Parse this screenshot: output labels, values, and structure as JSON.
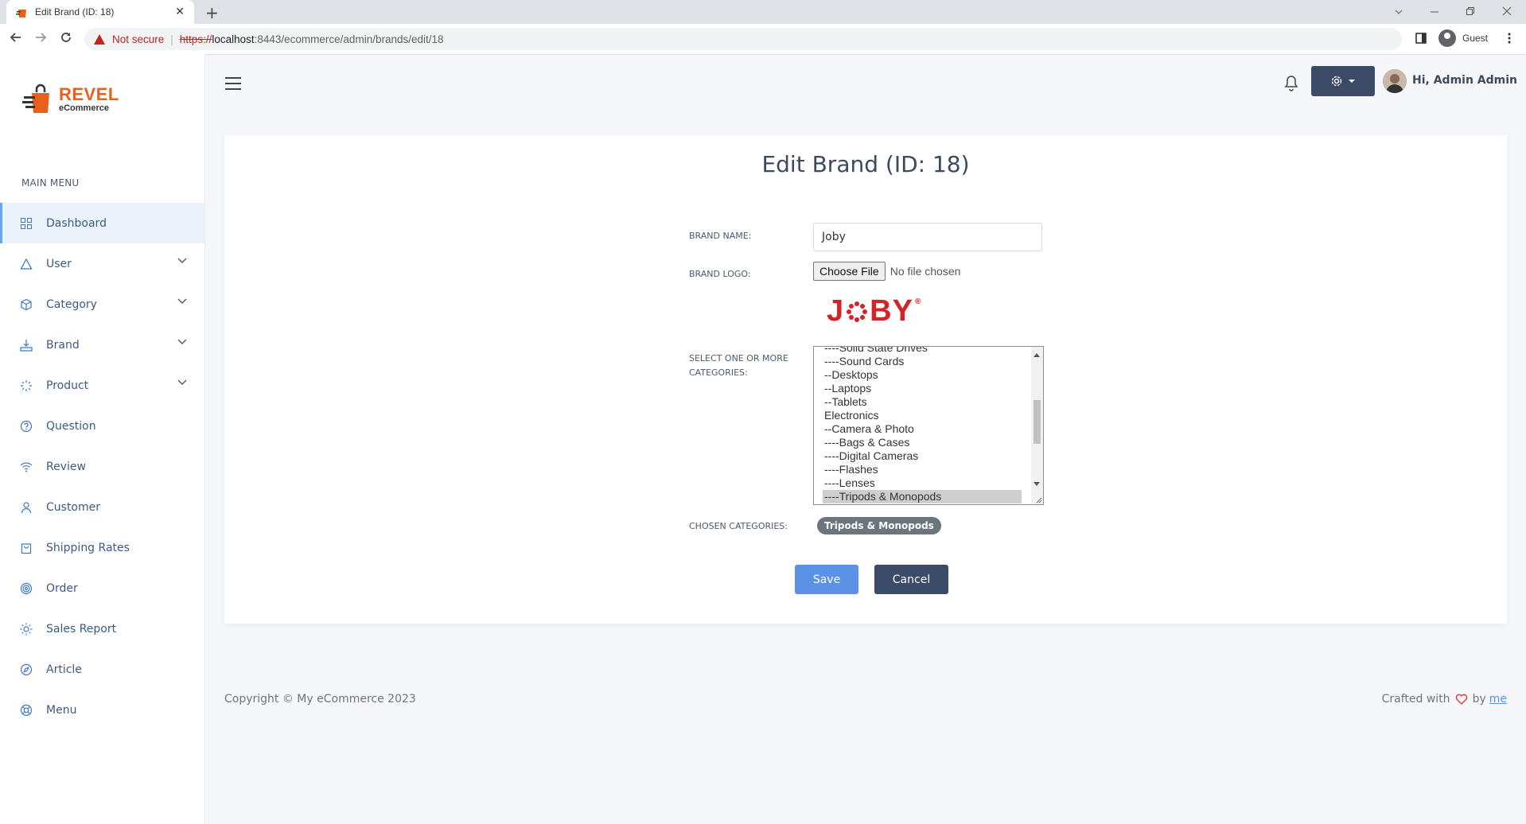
{
  "browser": {
    "tab_title": "Edit Brand (ID: 18)",
    "tab_close": "✕",
    "new_tab": "+",
    "not_secure": "Not secure",
    "url_scheme": "https://",
    "url_host": "localhost",
    "url_path": ":8443/ecommerce/admin/brands/edit/18",
    "profile": "Guest"
  },
  "sidebar": {
    "logo_name": "REVEL",
    "logo_sub": "eCommerce",
    "heading": "MAIN MENU",
    "items": [
      {
        "label": "Dashboard",
        "icon": "grid-icon",
        "active": true,
        "has_children": false
      },
      {
        "label": "User",
        "icon": "triangle-icon",
        "active": false,
        "has_children": true
      },
      {
        "label": "Category",
        "icon": "box-icon",
        "active": false,
        "has_children": true
      },
      {
        "label": "Brand",
        "icon": "brand-icon",
        "active": false,
        "has_children": true
      },
      {
        "label": "Product",
        "icon": "loader-icon",
        "active": false,
        "has_children": true
      },
      {
        "label": "Question",
        "icon": "help-circle-icon",
        "active": false,
        "has_children": false
      },
      {
        "label": "Review",
        "icon": "wifi-icon",
        "active": false,
        "has_children": false
      },
      {
        "label": "Customer",
        "icon": "user-icon",
        "active": false,
        "has_children": false
      },
      {
        "label": "Shipping Rates",
        "icon": "bag-icon",
        "active": false,
        "has_children": false
      },
      {
        "label": "Order",
        "icon": "target-icon",
        "active": false,
        "has_children": false
      },
      {
        "label": "Sales Report",
        "icon": "sun-icon",
        "active": false,
        "has_children": false
      },
      {
        "label": "Article",
        "icon": "compass-icon",
        "active": false,
        "has_children": false
      },
      {
        "label": "Menu",
        "icon": "globe-icon",
        "active": false,
        "has_children": false
      }
    ]
  },
  "header": {
    "greeting": "Hi, Admin Admin"
  },
  "form": {
    "title": "Edit Brand (ID: 18)",
    "brand_name_label": "BRAND NAME:",
    "brand_name_value": "Joby",
    "brand_logo_label": "BRAND LOGO:",
    "choose_file": "Choose File",
    "file_status": "No file chosen",
    "logo_text_j": "J",
    "logo_text_rest": "BY",
    "logo_reg": "®",
    "categories_label": "SELECT ONE OR MORE CATEGORIES:",
    "category_options": [
      {
        "label": "----Solid State Drives",
        "selected": false
      },
      {
        "label": "----Sound Cards",
        "selected": false
      },
      {
        "label": "--Desktops",
        "selected": false
      },
      {
        "label": "--Laptops",
        "selected": false
      },
      {
        "label": "--Tablets",
        "selected": false
      },
      {
        "label": "Electronics",
        "selected": false
      },
      {
        "label": "--Camera & Photo",
        "selected": false
      },
      {
        "label": "----Bags & Cases",
        "selected": false
      },
      {
        "label": "----Digital Cameras",
        "selected": false
      },
      {
        "label": "----Flashes",
        "selected": false
      },
      {
        "label": "----Lenses",
        "selected": false
      },
      {
        "label": "----Tripods & Monopods",
        "selected": true
      }
    ],
    "chosen_label": "CHOSEN CATEGORIES:",
    "chosen": [
      "Tripods & Monopods"
    ],
    "save": "Save",
    "cancel": "Cancel"
  },
  "footer": {
    "copyright": "Copyright © My eCommerce 2023",
    "crafted": "Crafted with",
    "by": "by",
    "me": "me"
  },
  "colors": {
    "accent": "#5b92e6",
    "dark": "#3b4a66",
    "brand_orange": "#e8601c",
    "joby_red": "#d32228"
  }
}
